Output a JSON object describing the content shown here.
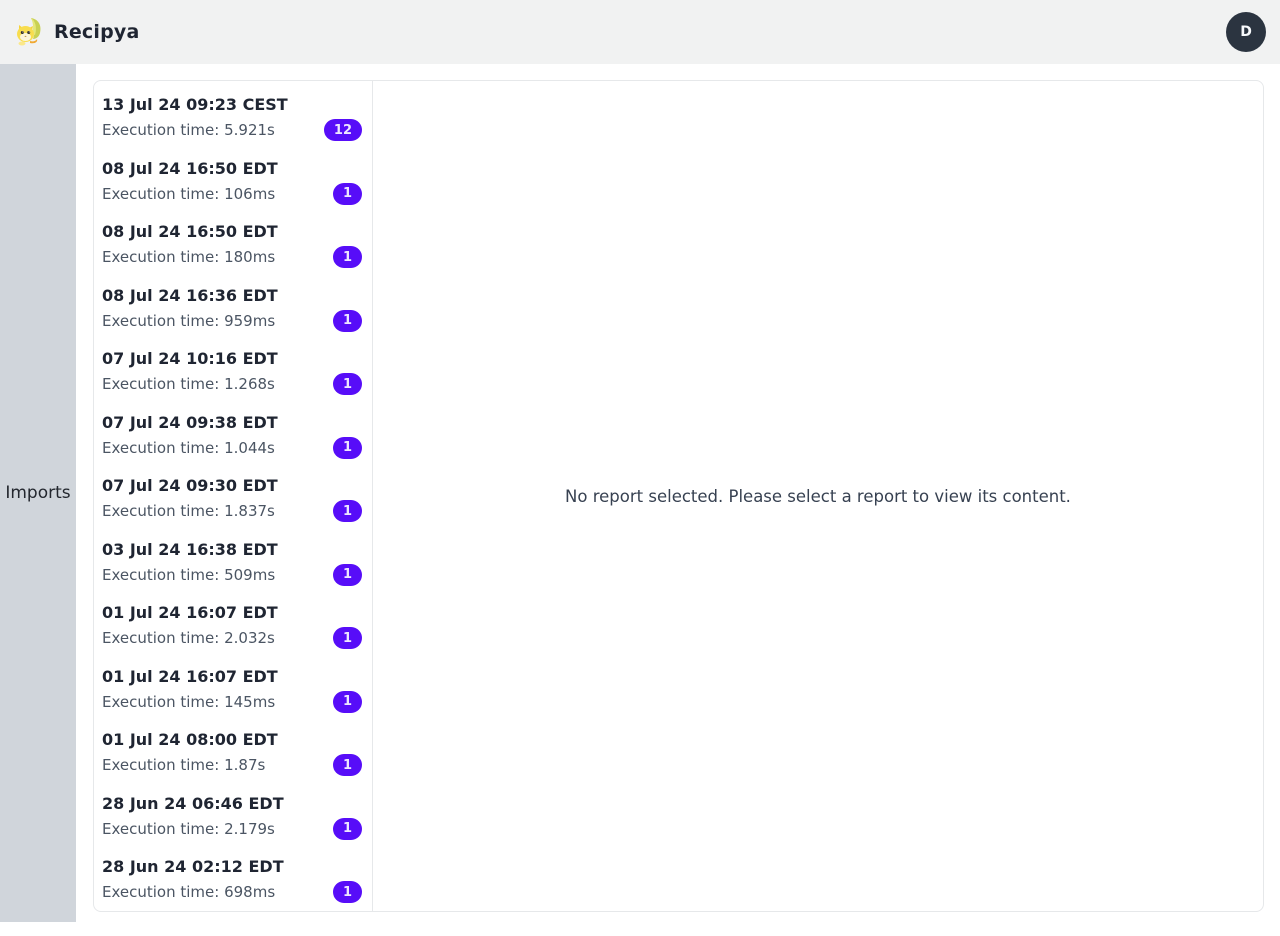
{
  "header": {
    "app_title": "Recipya",
    "avatar_initial": "D"
  },
  "sidebar": {
    "tabs": [
      {
        "label": "Imports"
      }
    ]
  },
  "reports": {
    "empty_message": "No report selected. Please select a report to view its content.",
    "items": [
      {
        "title": "13 Jul 24 09:23 CEST",
        "subtitle": "Execution time: 5.921s",
        "count": "12"
      },
      {
        "title": "08 Jul 24 16:50 EDT",
        "subtitle": "Execution time: 106ms",
        "count": "1"
      },
      {
        "title": "08 Jul 24 16:50 EDT",
        "subtitle": "Execution time: 180ms",
        "count": "1"
      },
      {
        "title": "08 Jul 24 16:36 EDT",
        "subtitle": "Execution time: 959ms",
        "count": "1"
      },
      {
        "title": "07 Jul 24 10:16 EDT",
        "subtitle": "Execution time: 1.268s",
        "count": "1"
      },
      {
        "title": "07 Jul 24 09:38 EDT",
        "subtitle": "Execution time: 1.044s",
        "count": "1"
      },
      {
        "title": "07 Jul 24 09:30 EDT",
        "subtitle": "Execution time: 1.837s",
        "count": "1"
      },
      {
        "title": "03 Jul 24 16:38 EDT",
        "subtitle": "Execution time: 509ms",
        "count": "1"
      },
      {
        "title": "01 Jul 24 16:07 EDT",
        "subtitle": "Execution time: 2.032s",
        "count": "1"
      },
      {
        "title": "01 Jul 24 16:07 EDT",
        "subtitle": "Execution time: 145ms",
        "count": "1"
      },
      {
        "title": "01 Jul 24 08:00 EDT",
        "subtitle": "Execution time: 1.87s",
        "count": "1"
      },
      {
        "title": "28 Jun 24 06:46 EDT",
        "subtitle": "Execution time: 2.179s",
        "count": "1"
      },
      {
        "title": "28 Jun 24 02:12 EDT",
        "subtitle": "Execution time: 698ms",
        "count": "1"
      }
    ]
  },
  "colors": {
    "badge_bg": "#570df8",
    "avatar_bg": "#2b3440",
    "sidebar_bg": "#d0d5db",
    "header_bg": "#f1f2f2",
    "panel_border": "#e6e8ea"
  },
  "icons": {
    "logo": "recipya-cat-banana-mascot"
  }
}
